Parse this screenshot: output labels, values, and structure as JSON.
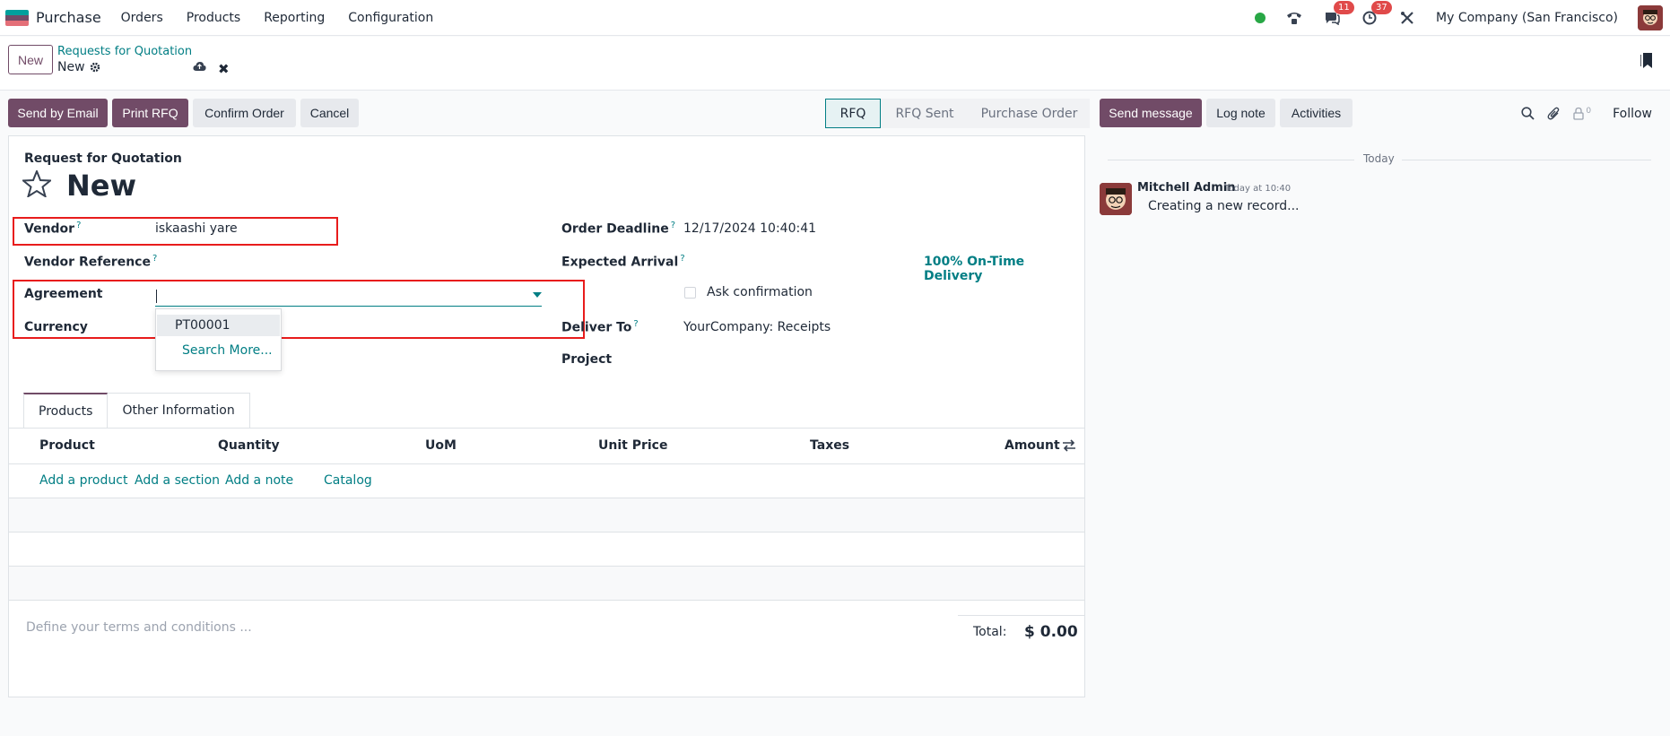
{
  "app": {
    "name": "Purchase",
    "icon_colors": [
      "#00a09d",
      "#714b67",
      "#e46f78"
    ]
  },
  "nav": {
    "menu": [
      "Orders",
      "Products",
      "Reporting",
      "Configuration"
    ],
    "messages_badge": "11",
    "activities_badge": "37",
    "company": "My Company (San Francisco)"
  },
  "control": {
    "new_label": "New",
    "breadcrumb": "Requests for Quotation",
    "record_name": "New"
  },
  "actions": {
    "send_email": "Send by Email",
    "print_rfq": "Print RFQ",
    "confirm": "Confirm Order",
    "cancel": "Cancel"
  },
  "statusbar": {
    "stages": [
      "RFQ",
      "RFQ Sent",
      "Purchase Order"
    ],
    "active": "RFQ"
  },
  "form": {
    "doc_type": "Request for Quotation",
    "title": "New",
    "vendor_label": "Vendor",
    "vendor_value": "iskaashi yare",
    "vendor_ref_label": "Vendor Reference",
    "agreement_label": "Agreement",
    "currency_label": "Currency",
    "order_deadline_label": "Order Deadline",
    "order_deadline_value": "12/17/2024 10:40:41",
    "expected_arrival_label": "Expected Arrival",
    "on_time": "100% On-Time Delivery",
    "ask_confirmation": "Ask confirmation",
    "deliver_to_label": "Deliver To",
    "deliver_to_value": "YourCompany: Receipts",
    "project_label": "Project",
    "help_mark": "?"
  },
  "dropdown": {
    "option": "PT00001",
    "search_more": "Search More..."
  },
  "tabs": [
    "Products",
    "Other Information"
  ],
  "table": {
    "headers": [
      "Product",
      "Quantity",
      "UoM",
      "Unit Price",
      "Taxes",
      "Amount"
    ],
    "add_product": "Add a product",
    "add_section": "Add a section",
    "add_note": "Add a note",
    "catalog": "Catalog"
  },
  "footer": {
    "terms_placeholder": "Define your terms and conditions ...",
    "total_label": "Total:",
    "total_value": "$ 0.00"
  },
  "chatter": {
    "send_message": "Send message",
    "log_note": "Log note",
    "activities": "Activities",
    "followers_count": "0",
    "follow": "Follow",
    "date_separator": "Today",
    "author": "Mitchell Admin",
    "time": "Today at 10:40",
    "message": "Creating a new record..."
  }
}
